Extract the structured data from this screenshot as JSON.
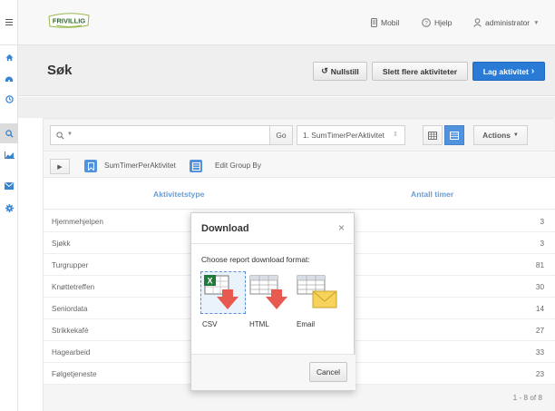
{
  "brand": {
    "logo_text": "FRIVILLIG"
  },
  "topnav": {
    "mobile": "Mobil",
    "help": "Hjelp",
    "user": "administrator"
  },
  "page": {
    "title": "Søk",
    "reset_label": "Nullstill",
    "delete_label": "Slett flere aktiviteter",
    "create_label": "Lag aktivitet"
  },
  "search": {
    "query": "",
    "go_label": "Go",
    "report_select": "1. SumTimerPerAktivitet",
    "actions_label": "Actions"
  },
  "grouping": {
    "report_name": "SumTimerPerAktivitet",
    "edit_label": "Edit Group By"
  },
  "table": {
    "columns": [
      "Aktivitetstype",
      "Antall timer"
    ],
    "rows": [
      [
        "Hjemmehjelpen",
        "3"
      ],
      [
        "Sjøkk",
        "3"
      ],
      [
        "Turgrupper",
        "81"
      ],
      [
        "Knøttetreffen",
        "30"
      ],
      [
        "Seniordata",
        "14"
      ],
      [
        "Strikkekafè",
        "27"
      ],
      [
        "Hagearbeid",
        "33"
      ],
      [
        "Følgetjeneste",
        "23"
      ]
    ],
    "pagination": "1 - 8 of 8"
  },
  "modal": {
    "title": "Download",
    "close": "×",
    "prompt": "Choose report download format:",
    "formats": [
      {
        "label": "CSV",
        "icon": "csv-excel-icon"
      },
      {
        "label": "HTML",
        "icon": "html-table-icon"
      },
      {
        "label": "Email",
        "icon": "email-icon"
      }
    ],
    "cancel_label": "Cancel"
  },
  "colors": {
    "accent": "#2a7bd6",
    "header_link": "#4a88c9",
    "rail_icon": "#3a83cf"
  }
}
